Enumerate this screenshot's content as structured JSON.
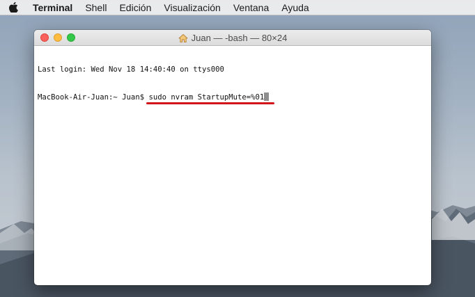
{
  "menubar": {
    "apple_icon": "apple-logo-icon",
    "app_name": "Terminal",
    "items": [
      "Shell",
      "Edición",
      "Visualización",
      "Ventana",
      "Ayuda"
    ]
  },
  "window": {
    "title": "Juan — -bash — 80×24",
    "title_icon": "home-icon",
    "traffic_lights": {
      "close": "#fc605b",
      "minimize": "#fdbc40",
      "zoom": "#34c84a"
    }
  },
  "terminal": {
    "login_line": "Last login: Wed Nov 18 14:40:40 on ttys000",
    "prompt": "MacBook-Air-Juan:~ Juan$ ",
    "command": "sudo nvram StartupMute=%01",
    "highlight_color": "#d0161b"
  }
}
